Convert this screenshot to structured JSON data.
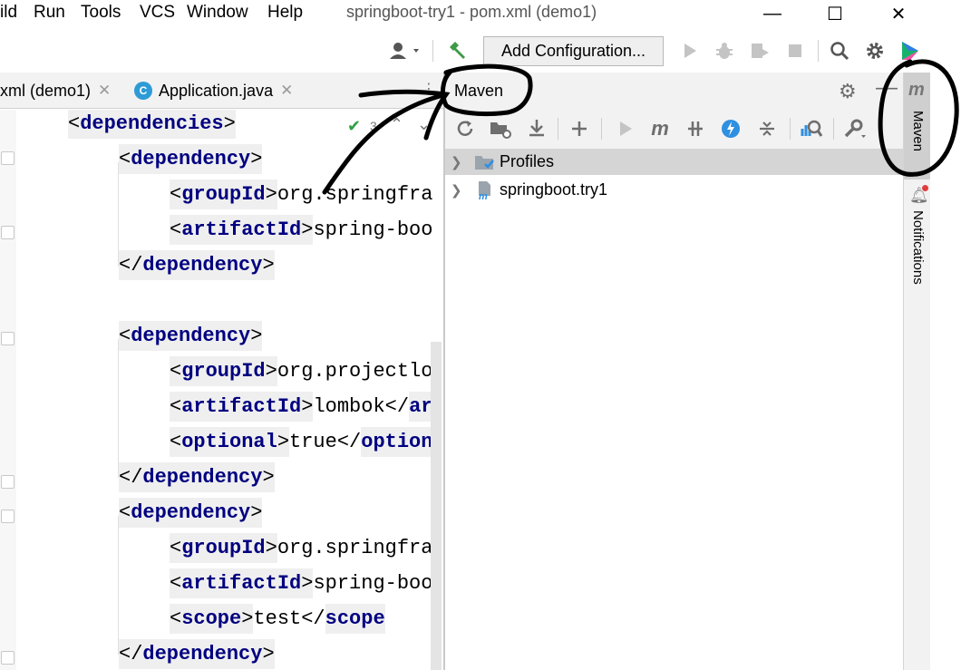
{
  "menu": {
    "items": [
      {
        "id": "build",
        "label": "ild"
      },
      {
        "id": "run",
        "label": "Run"
      },
      {
        "id": "tools",
        "label": "Tools"
      },
      {
        "id": "vcs",
        "label": "VCS"
      },
      {
        "id": "window",
        "label": "Window"
      },
      {
        "id": "help",
        "label": "Help"
      }
    ],
    "window_title": "springboot-try1 - pom.xml (demo1)"
  },
  "window_controls": {
    "minimize": "—",
    "maximize": "☐",
    "close": "✕"
  },
  "toolbar": {
    "add_configuration_label": "Add Configuration...",
    "icons": [
      "user-icon",
      "build-hammer-icon",
      "run-icon",
      "debug-icon",
      "coverage-icon",
      "stop-icon",
      "search-icon",
      "settings-icon",
      "toolbox-icon"
    ]
  },
  "tabs": [
    {
      "label": "xml (demo1)",
      "close": "✕"
    },
    {
      "label": "Application.java",
      "close": "✕",
      "icon_letter": "C"
    }
  ],
  "editor": {
    "inspection_count": "3",
    "lines": [
      {
        "open": "dependencies",
        "text": "",
        "close": ""
      },
      {
        "open": "dependency",
        "text": "",
        "close": ""
      },
      {
        "open": "groupId",
        "text": "org.springfra",
        "close": ""
      },
      {
        "open": "artifactId",
        "text": "spring-boo",
        "close": ""
      },
      {
        "open": "",
        "text": "",
        "close": "dependency"
      },
      {
        "open": "",
        "text": "",
        "close": ""
      },
      {
        "open": "dependency",
        "text": "",
        "close": ""
      },
      {
        "open": "groupId",
        "text": "org.projectlo",
        "close": ""
      },
      {
        "open": "artifactId",
        "text": "lombok</",
        "close": "ar"
      },
      {
        "open": "optional",
        "text": "true</",
        "close": "option"
      },
      {
        "open": "",
        "text": "",
        "close": "dependency"
      },
      {
        "open": "dependency",
        "text": "",
        "close": ""
      },
      {
        "open": "groupId",
        "text": "org.springfra",
        "close": ""
      },
      {
        "open": "artifactId",
        "text": "spring-boo",
        "close": ""
      },
      {
        "open": "scope",
        "text": "test</",
        "close": "scope"
      },
      {
        "open": "",
        "text": "",
        "close": "dependency"
      }
    ]
  },
  "maven": {
    "title": "Maven",
    "tree": [
      {
        "label": "Profiles",
        "icon": "profiles-folder-icon",
        "selected": true
      },
      {
        "label": "springboot.try1",
        "icon": "maven-project-icon",
        "selected": false
      }
    ],
    "toolbar_icons": [
      "reload-icon",
      "reimport-folder-icon",
      "download-icon",
      "add-icon",
      "run-icon",
      "maven-goal-icon",
      "toggle-offline-icon",
      "skip-tests-icon",
      "collapse-all-icon",
      "analyze-icon",
      "settings-wrench-icon"
    ]
  },
  "right_strip": {
    "maven_label": "Maven",
    "notifications_label": "Notifications"
  },
  "colors": {
    "tag_name": "#000080",
    "annotation": "#000000",
    "notification_dot": "#e03c3c"
  }
}
